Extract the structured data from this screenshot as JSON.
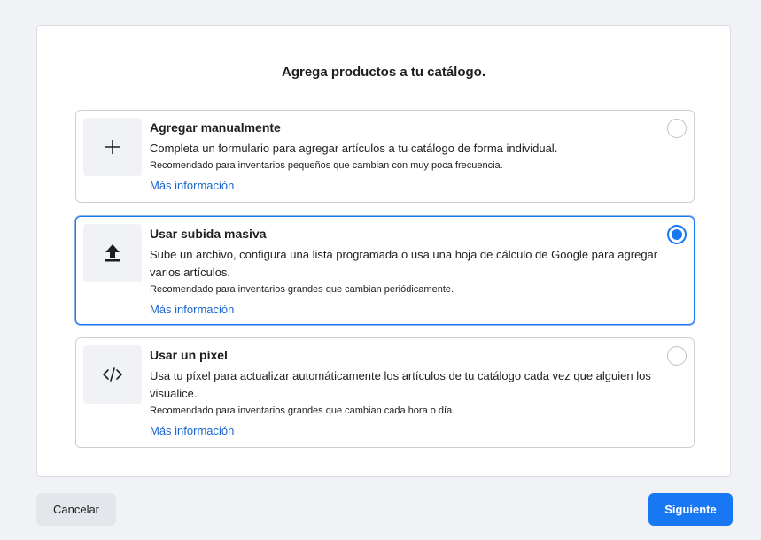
{
  "title": "Agrega productos a tu catálogo.",
  "options": [
    {
      "icon": "plus-icon",
      "title": "Agregar manualmente",
      "description": "Completa un formulario para agregar artículos a tu catálogo de forma individual.",
      "recommendation": "Recomendado para inventarios pequeños que cambian con muy poca frecuencia.",
      "link": "Más información",
      "selected": false
    },
    {
      "icon": "upload-icon",
      "title": "Usar subida masiva",
      "description": "Sube un archivo, configura una lista programada o usa una hoja de cálculo de Google para agregar varios artículos.",
      "recommendation": "Recomendado para inventarios grandes que cambian periódicamente.",
      "link": "Más información",
      "selected": true
    },
    {
      "icon": "code-icon",
      "title": "Usar un píxel",
      "description": "Usa tu píxel para actualizar automáticamente los artículos de tu catálogo cada vez que alguien los visualice.",
      "recommendation": "Recomendado para inventarios grandes que cambian cada hora o día.",
      "link": "Más información",
      "selected": false
    }
  ],
  "buttons": {
    "cancel": "Cancelar",
    "next": "Siguiente"
  },
  "colors": {
    "accent": "#1877f2",
    "link": "#1b65cf",
    "background": "#f0f2f5"
  }
}
